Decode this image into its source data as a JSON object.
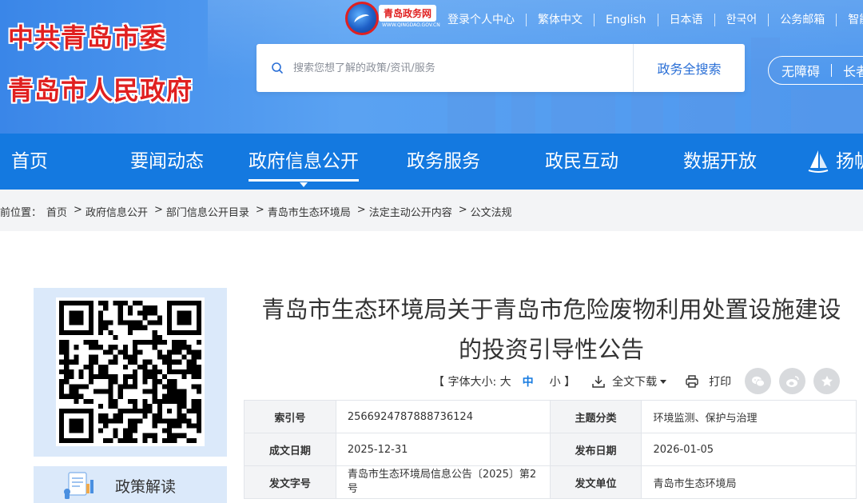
{
  "header": {
    "org_line1": "中共青岛市委",
    "org_line2": "青岛市人民政府",
    "portal_name": "青岛政务网",
    "portal_url": "WWW.QINGDAO.GOV.CN",
    "top_links": [
      "登录个人中心",
      "繁体中文",
      "English",
      "日本语",
      "한국어",
      "公务邮箱",
      "智能"
    ],
    "search_placeholder": "搜索您想了解的政策/资讯/服务",
    "search_button": "政务全搜索",
    "access_items": [
      "无障碍",
      "长者"
    ]
  },
  "nav": {
    "items": [
      "首页",
      "要闻动态",
      "政府信息公开",
      "政务服务",
      "政民互动",
      "数据开放",
      "扬帆"
    ],
    "active_index": 2
  },
  "breadcrumb": {
    "prefix": "前位置：",
    "items": [
      "首页",
      "政府信息公开",
      "部门信息公开目录",
      "青岛市生态环境局",
      "法定主动公开内容",
      "公文法规"
    ],
    "separator": ">"
  },
  "sidebar": {
    "policy_label": "政策解读"
  },
  "article": {
    "title_line1": "青岛市生态环境局关于青岛市危险废物利用处置设施建设",
    "title_line2": "的投资引导性公告",
    "tools": {
      "font_size_label": "【 字体大小: 大",
      "mid": "中",
      "small": "小 】",
      "download": "全文下载",
      "print": "打印"
    }
  },
  "meta": {
    "rows": [
      {
        "k1": "索引号",
        "v1": "2566924787888736124",
        "k2": "主题分类",
        "v2": "环境监测、保护与治理"
      },
      {
        "k1": "成文日期",
        "v1": "2025-12-31",
        "k2": "发布日期",
        "v2": "2026-01-05"
      },
      {
        "k1": "发文字号",
        "v1": "青岛市生态环境局信息公告〔2025〕第2号",
        "k2": "发文单位",
        "v2": "青岛市生态环境局"
      }
    ]
  },
  "colors": {
    "nav_blue": "#1479e0",
    "logo_red": "#e02020",
    "panel_blue": "#dbe9fa"
  }
}
